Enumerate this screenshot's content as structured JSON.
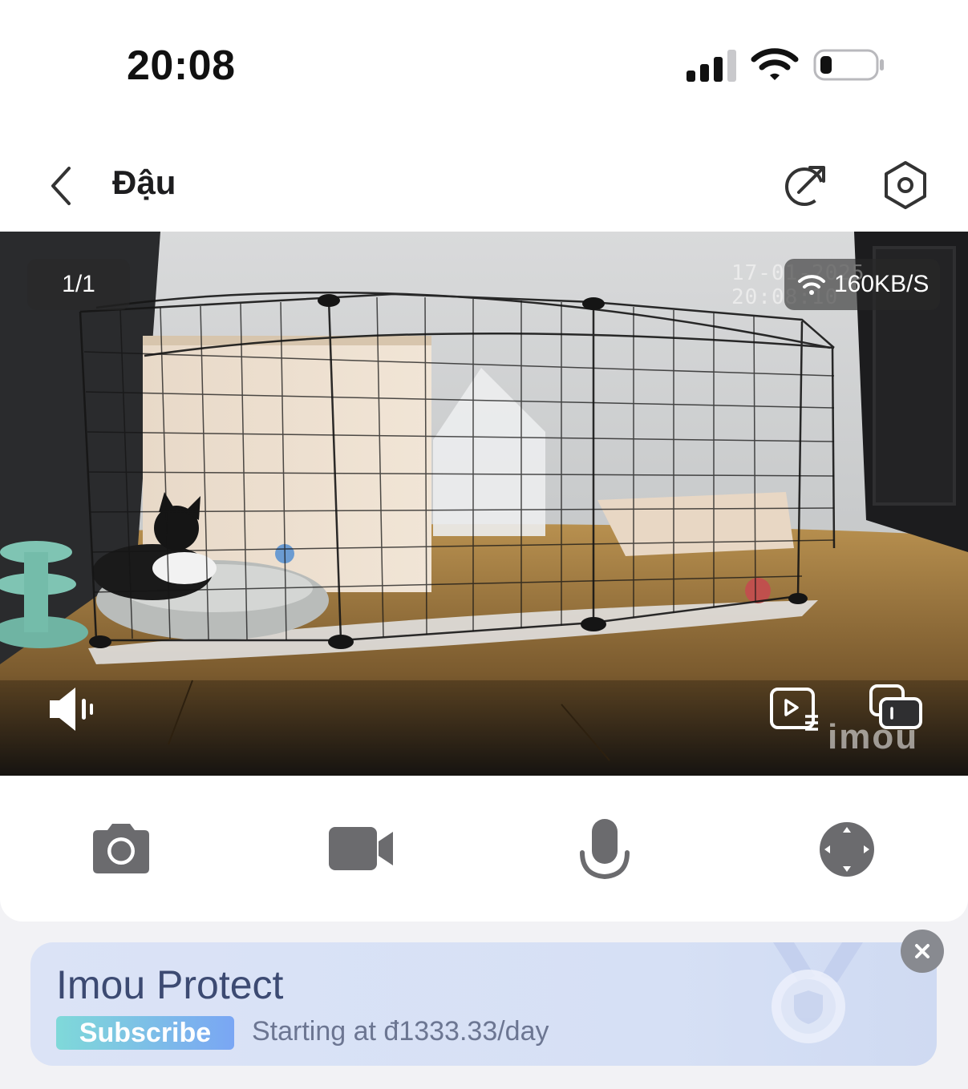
{
  "status_bar": {
    "time": "20:08"
  },
  "header": {
    "title": "Đậu"
  },
  "video": {
    "page_counter": "1/1",
    "timestamp": "17-01-2025 20:08:10",
    "speed": "160KB/S",
    "watermark": "imou"
  },
  "controls": {
    "items": [
      "camera-icon",
      "video-record-icon",
      "microphone-icon",
      "ptz-joystick-icon"
    ]
  },
  "promo": {
    "title": "Imou Protect",
    "subscribe_label": "Subscribe",
    "price_text": "Starting at đ1333.33/day"
  },
  "colors": {
    "promo_bg": "#dbe3f6",
    "promo_title": "#3c4a72",
    "subscribe_gradient_start": "#7fd9d9",
    "subscribe_gradient_end": "#7aa6f4",
    "icon_gray": "#6b6b6e"
  }
}
